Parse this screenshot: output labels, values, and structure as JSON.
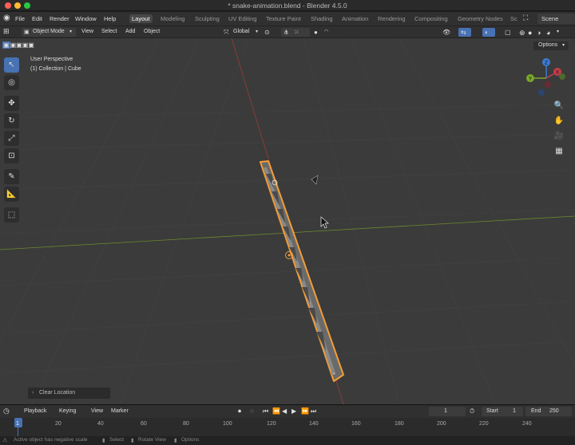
{
  "window": {
    "title": "* snake-animation.blend - Blender 4.5.0"
  },
  "menubar": {
    "items": [
      "File",
      "Edit",
      "Render",
      "Window",
      "Help"
    ],
    "workspaces": [
      "Layout",
      "Modeling",
      "Sculpting",
      "UV Editing",
      "Texture Paint",
      "Shading",
      "Animation",
      "Rendering",
      "Compositing",
      "Geometry Nodes",
      "Sc"
    ],
    "scene": "Scene"
  },
  "header": {
    "mode": "Object Mode",
    "menus": [
      "View",
      "Select",
      "Add",
      "Object"
    ],
    "transform_orientation": "Global",
    "options_label": "Options"
  },
  "viewport": {
    "perspective_label": "User Perspective",
    "collection_label": "(1) Collection | Cube",
    "last_operator": "Clear Location",
    "gizmo": {
      "x": "X",
      "y": "Y",
      "z": "Z"
    }
  },
  "timeline": {
    "menus": [
      "Playback",
      "Keying",
      "View",
      "Marker"
    ],
    "current_frame": "1",
    "start_label": "Start",
    "start": "1",
    "end_label": "End",
    "end": "250",
    "ruler": [
      "1",
      "20",
      "40",
      "60",
      "80",
      "100",
      "120",
      "140",
      "160",
      "180",
      "200",
      "220",
      "240"
    ]
  },
  "statusbar": {
    "message": "Active object has negative scale",
    "hints": [
      "Select",
      "Rotate View",
      "Options"
    ]
  },
  "colors": {
    "accent": "#4772b3",
    "selection_outline": "#f29d38",
    "x_axis": "#9a3b3b",
    "y_axis": "#6d8a2c"
  }
}
